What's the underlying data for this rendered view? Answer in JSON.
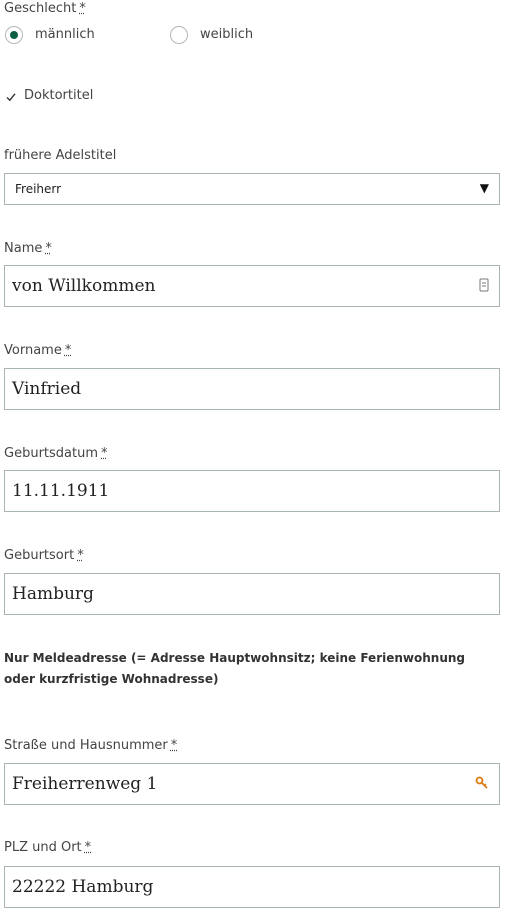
{
  "gender": {
    "label": "Geschlecht",
    "required_mark": "*",
    "options": [
      {
        "label": "männlich",
        "selected": true
      },
      {
        "label": "weiblich",
        "selected": false
      }
    ]
  },
  "doctor_title": {
    "label": "Doktortitel",
    "checked": true
  },
  "noble_title": {
    "label": "frühere Adelstitel",
    "value": "Freiherr"
  },
  "name": {
    "label": "Name",
    "required_mark": "*",
    "value": "von Willkommen"
  },
  "first_name": {
    "label": "Vorname",
    "required_mark": "*",
    "value": "Vinfried"
  },
  "birth_date": {
    "label": "Geburtsdatum",
    "required_mark": "*",
    "value": "11.11.1911"
  },
  "birth_place": {
    "label": "Geburtsort",
    "required_mark": "*",
    "value": "Hamburg"
  },
  "address_note": "Nur Meldeadresse (= Adresse Hauptwohnsitz; keine Ferienwohnung oder kurzfristige Wohnadresse)",
  "street": {
    "label": "Straße und Hausnummer",
    "required_mark": "*",
    "value": "Freiherrenweg 1"
  },
  "zip_city": {
    "label": "PLZ und Ort",
    "required_mark": "*",
    "value": "22222 Hamburg"
  },
  "colors": {
    "accent": "#0c5f45",
    "border": "#aab5b1",
    "autofill_icon": "#e07a16"
  },
  "icons": {
    "select_arrow": "dropdown-arrow-icon",
    "name_field": "contact-card-icon",
    "street_field": "autofill-key-icon"
  }
}
